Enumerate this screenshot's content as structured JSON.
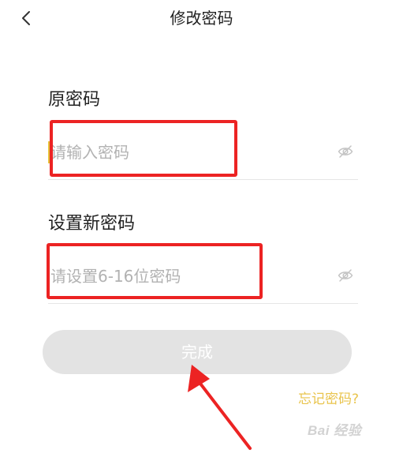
{
  "header": {
    "title": "修改密码",
    "back_icon": "chevron-left-icon"
  },
  "form": {
    "old_password": {
      "label": "原密码",
      "placeholder": "请输入密码",
      "value": "",
      "visibility_icon": "eye-icon"
    },
    "new_password": {
      "label": "设置新密码",
      "placeholder": "请设置6-16位密码",
      "value": "",
      "visibility_icon": "eye-icon"
    },
    "submit_label": "完成",
    "forgot_link": "忘记密码?"
  },
  "watermark": "Bai 经验",
  "colors": {
    "accent": "#e9c44d",
    "annotation": "#ec2323",
    "button_disabled": "#e3e3e3",
    "placeholder": "#b2b2b2"
  }
}
